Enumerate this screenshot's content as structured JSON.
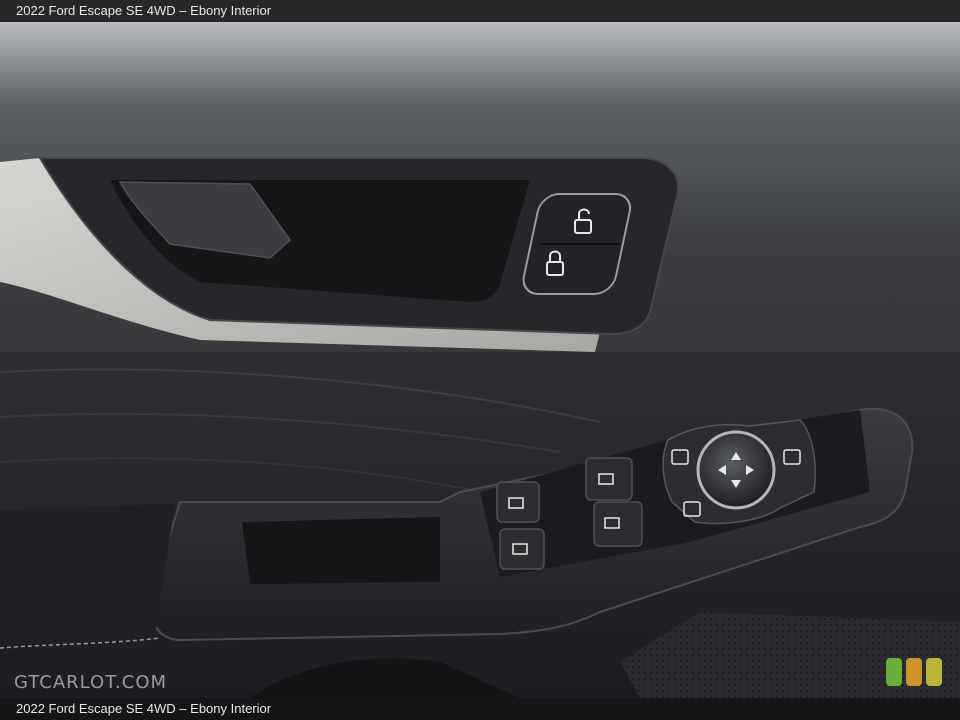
{
  "caption": {
    "top": "2022 Ford Escape SE 4WD – Ebony Interior",
    "bottom": "2022 Ford Escape SE 4WD – Ebony Interior"
  },
  "watermark": {
    "text": "GTCARLOT.COM"
  },
  "badge_colors": [
    "#6fbf3a",
    "#e0a02a",
    "#c9c43a"
  ],
  "icons": {
    "lock": "lock-icon",
    "unlock": "unlock-icon",
    "window": "window-switch-icon",
    "mirror": "mirror-adjust-icon"
  }
}
